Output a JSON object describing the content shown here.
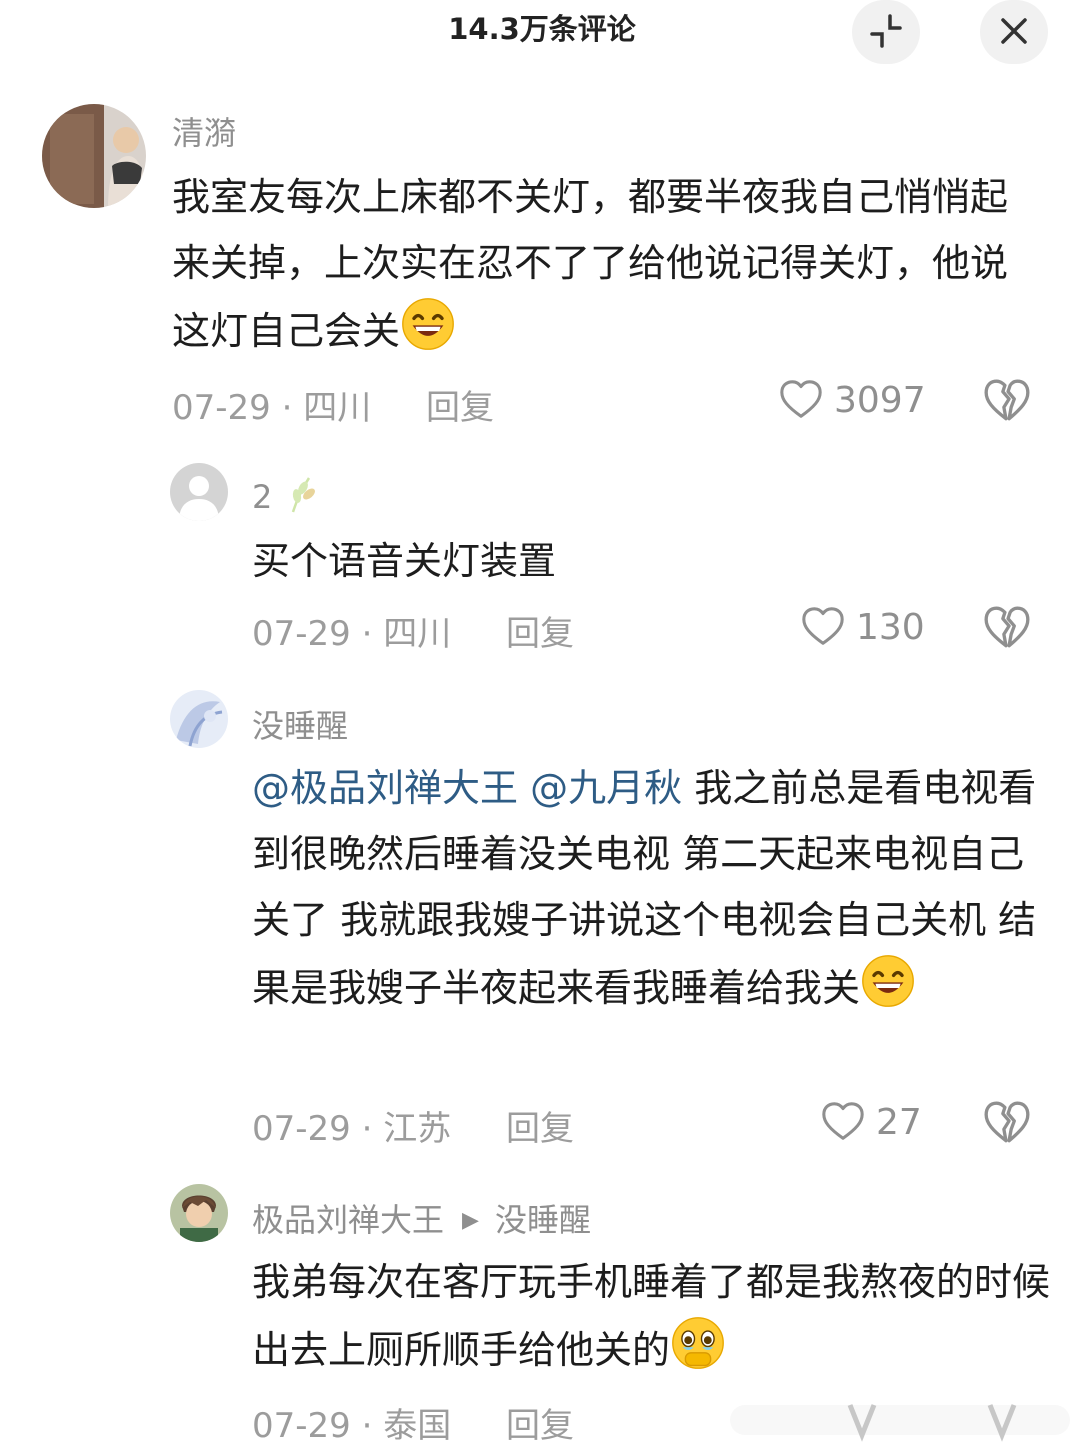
{
  "header": {
    "title": "14.3万条评论",
    "collapse_icon": "collapse-icon",
    "close_icon": "close-icon"
  },
  "comments": [
    {
      "user": "清漪",
      "text": "我室友每次上床都不关灯，都要半夜我自己悄悄起来关掉，上次实在忍不了了给他说记得关灯，他说这灯自己会关",
      "emoji": "grinning-face-emoji",
      "date": "07-29",
      "location": "四川",
      "reply_label": "回复",
      "likes": "3097"
    },
    {
      "user": "2",
      "user_badge": "wheat-badge-icon",
      "text": "买个语音关灯装置",
      "date": "07-29",
      "location": "四川",
      "reply_label": "回复",
      "likes": "130"
    },
    {
      "user": "没睡醒",
      "mentions": [
        "@极品刘禅大王",
        "@九月秋"
      ],
      "text": "我之前总是看电视看到很晚然后睡着没关电视 第二天起来电视自己关了 我就跟我嫂子讲说这个电视会自己关机 结果是我嫂子半夜起来看我睡着给我关",
      "emoji": "grinning-face-emoji",
      "date": "07-29",
      "location": "江苏",
      "reply_label": "回复",
      "likes": "27"
    },
    {
      "user": "极品刘禅大王",
      "reply_to": "没睡醒",
      "text": "我弟每次在客厅玩手机睡着了都是我熬夜的时候出去上厕所顺手给他关的",
      "emoji": "holding-back-tears-emoji",
      "date": "07-29",
      "location": "泰国",
      "reply_label": "回复"
    }
  ],
  "separator": "·",
  "colors": {
    "mention": "#2e5c85",
    "meta": "#9c9c9c",
    "username": "#8f8f8f",
    "header_button_bg": "#f1f1f1"
  }
}
